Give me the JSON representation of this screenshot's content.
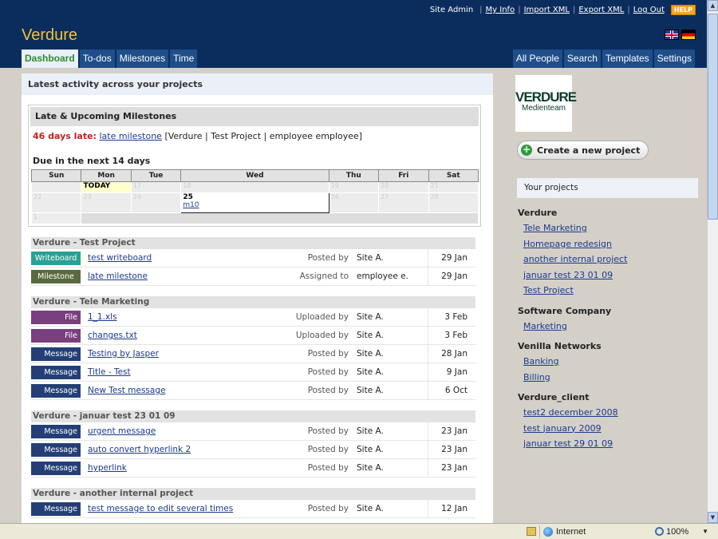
{
  "header": {
    "brand": "Verdure",
    "user_label": "Site Admin",
    "top_links": [
      "My Info",
      "Import XML",
      "Export XML",
      "Log Out"
    ],
    "help_label": "HELP",
    "tabs_left": [
      {
        "label": "Dashboard",
        "active": true
      },
      {
        "label": "To-dos"
      },
      {
        "label": "Milestones"
      },
      {
        "label": "Time"
      }
    ],
    "tabs_right": [
      {
        "label": "All People"
      },
      {
        "label": "Search"
      },
      {
        "label": "Templates"
      },
      {
        "label": "Settings"
      }
    ]
  },
  "main": {
    "heading": "Latest activity across your projects",
    "milestones": {
      "title": "Late & Upcoming Milestones",
      "late_label": "46 days late:",
      "late_link": "late milestone",
      "late_detail": "[Verdure | Test Project | employee employee]",
      "due_label": "Due in the next 14 days",
      "days": [
        "Sun",
        "Mon",
        "Tue",
        "Wed",
        "Thu",
        "Fri",
        "Sat"
      ],
      "week1": [
        "",
        "TODAY",
        "17",
        "18",
        "19",
        "20",
        "21"
      ],
      "week2": [
        "22",
        "23",
        "24",
        "25",
        "26",
        "27",
        "28"
      ],
      "week3": [
        "1"
      ],
      "highlight_link": "m10"
    },
    "groups": [
      {
        "title": "Verdure - Test Project",
        "rows": [
          {
            "type": "Writeboard",
            "title": "test writeboard",
            "action": "Posted by",
            "user": "Site A.",
            "date": "29 Jan"
          },
          {
            "type": "Milestone",
            "title": "late milestone",
            "action": "Assigned to",
            "user": "employee e.",
            "date": "29 Jan"
          }
        ]
      },
      {
        "title": "Verdure - Tele Marketing",
        "rows": [
          {
            "type": "File",
            "title": "1_1.xls",
            "action": "Uploaded by",
            "user": "Site A.",
            "date": "3 Feb"
          },
          {
            "type": "File",
            "title": "changes.txt",
            "action": "Uploaded by",
            "user": "Site A.",
            "date": "3 Feb"
          },
          {
            "type": "Message",
            "title": "Testing by Jasper",
            "action": "Posted by",
            "user": "Site A.",
            "date": "28 Jan"
          },
          {
            "type": "Message",
            "title": "Title - Test",
            "action": "Posted by",
            "user": "Site A.",
            "date": "9 Jan"
          },
          {
            "type": "Message",
            "title": "New Test message",
            "action": "Posted by",
            "user": "Site A.",
            "date": "6 Oct"
          }
        ]
      },
      {
        "title": "Verdure - januar test 23 01 09",
        "rows": [
          {
            "type": "Message",
            "title": "urgent message",
            "action": "Posted by",
            "user": "Site A.",
            "date": "23 Jan"
          },
          {
            "type": "Message",
            "title": "auto convert hyperlink 2",
            "action": "Posted by",
            "user": "Site A.",
            "date": "23 Jan"
          },
          {
            "type": "Message",
            "title": "hyperlink",
            "action": "Posted by",
            "user": "Site A.",
            "date": "23 Jan"
          }
        ]
      },
      {
        "title": "Verdure - another internal project",
        "rows": [
          {
            "type": "Message",
            "title": "test message to edit several times",
            "action": "Posted by",
            "user": "Site A.",
            "date": "12 Jan"
          }
        ]
      }
    ]
  },
  "sidebar": {
    "logo_title": "VERDURE",
    "logo_subtitle": "Medienteam",
    "create_button": "Create a new project",
    "your_projects": "Your projects",
    "companies": [
      {
        "name": "Verdure",
        "projects": [
          "Tele Marketing",
          "Homepage redesign",
          "another internal project",
          "januar test 23 01 09",
          "Test Project"
        ]
      },
      {
        "name": "Software Company",
        "projects": [
          "Marketing"
        ]
      },
      {
        "name": "Venilla Networks",
        "projects": [
          "Banking",
          "Billing"
        ]
      },
      {
        "name": "Verdure_client",
        "projects": [
          "test2 december 2008",
          "test january 2009",
          "januar test 29 01 09"
        ]
      }
    ]
  },
  "statusbar": {
    "zone": "Internet",
    "zoom": "100%"
  },
  "colors": {
    "header_bg": "#0b2d5e",
    "brand": "#f5c232",
    "active_tab_text": "#2e8b2e",
    "late": "#c8211e",
    "writeboard": "#2aa096",
    "milestone": "#5a6a3e",
    "file": "#7a3f7e",
    "message": "#243f76"
  },
  "icons": [
    "uk-flag-icon",
    "german-flag-icon",
    "plus-circle-icon",
    "globe-icon",
    "zoom-icon",
    "lock-icon"
  ]
}
